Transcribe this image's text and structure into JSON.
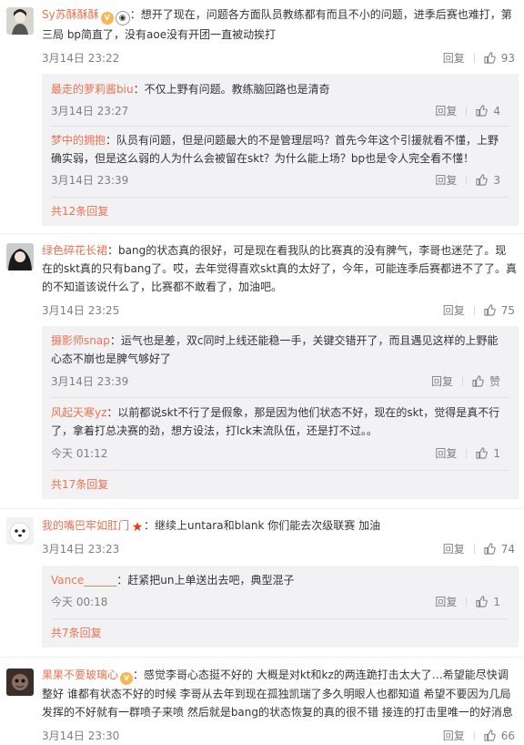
{
  "reply_label": "回复",
  "comments": [
    {
      "user": "Sy苏酥酥酥",
      "text": "想开了现在，问题各方面队员教练都有而且不小的问题，进季后赛也难打，第三局 bp简直了，没有aoe没有开团一直被动挨打",
      "time": "3月14日 23:22",
      "likes": "93",
      "replies": [
        {
          "user": "最走的萝莉酱biu",
          "text": "不仅上野有问题。教练脑回路也是清奇",
          "time": "3月14日 23:27",
          "likes": "4"
        },
        {
          "user": "梦中的拥抱",
          "text": "队员有问题，但是问题最大的不是管理层吗？首先今年这个引援就看不懂，上野确实弱，但是这么弱的人为什么会被留在skt？为什么能上场？bp也是令人完全看不懂！",
          "time": "3月14日 23:39",
          "likes": "3"
        }
      ],
      "more": "共12条回复"
    },
    {
      "user": "绿色碎花长裙",
      "text": "bang的状态真的很好，可是现在看我队的比赛真的没有脾气，李哥也迷茫了。现在的skt真的只有bang了。哎，去年觉得喜欢skt真的太好了，今年，可能连季后赛都进不了了。真的不知道该说什么了，比赛都不敢看了，加油吧。",
      "time": "3月14日 23:25",
      "likes": "75",
      "replies": [
        {
          "user": "摄影师snap",
          "text": "运气也是差，双c同时上线还能稳一手，关键交错开了，而且遇见这样的上野能心态不崩也是脾气够好了",
          "time": "3月14日 23:39",
          "likes": "赞"
        },
        {
          "user": "风起天寒yz",
          "text": "以前都说skt不行了是假象，那是因为他们状态不好，现在的skt，觉得是真不行了，拿着打总决赛的劲，想方设法，打lck末流队伍，还是打不过。。",
          "time": "今天 01:12",
          "likes": "1"
        }
      ],
      "more": "共17条回复"
    },
    {
      "user": "我的嘴巴牢如肛门",
      "text": "继续上untara和blank 你们能去次级联赛 加油",
      "time": "3月14日 23:23",
      "likes": "74",
      "replies": [
        {
          "user": "Vance______",
          "text": "赶紧把un上单送出去吧，典型混子",
          "time": "今天 00:18",
          "likes": "1"
        }
      ],
      "more": "共7条回复"
    },
    {
      "user": "果果不要玻璃心",
      "text": "感觉李哥心态挺不好的 大概是对kt和kz的两连跪打击太大了…希望能尽快调整好 谁都有状态不好的时候 李哥从去年到现在孤独凯瑞了多久明眼人也都知道 希望不要因为几局发挥的不好就有一群喷子来喷 然后就是bang的状态恢复的真的很不错 接连的打击里唯一的好消息",
      "time": "3月14日 23:30",
      "likes": "66",
      "replies": [],
      "more": ""
    }
  ]
}
